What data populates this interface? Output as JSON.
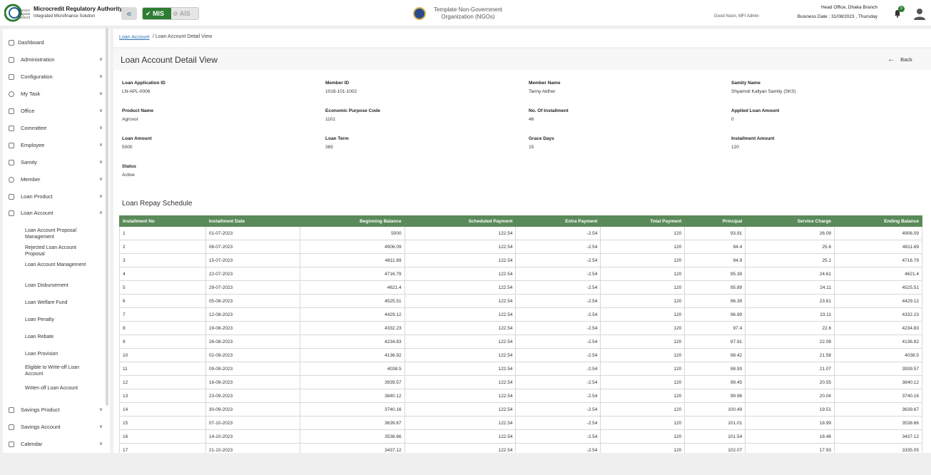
{
  "header": {
    "brand_title": "Microcredit Regulatory Authority",
    "brand_subtitle": "Integrated Microfinance Solution",
    "mode_mis": "MIS",
    "mode_ais": "AIS",
    "org_name": "Template Non-Government Organization (NGOs)",
    "greeting": "Good Noon, MFI Admin",
    "branch": "Head Office, Dhaka Branch",
    "business_date": "Business Date : 31/08/2023 , Thursday",
    "notification_count": "0"
  },
  "sidebar": {
    "dashboard": "Dashboard",
    "items": [
      {
        "label": "Administration",
        "icon": "admin-icon"
      },
      {
        "label": "Configuration",
        "icon": "config-icon"
      },
      {
        "label": "My Task",
        "icon": "task-icon"
      },
      {
        "label": "Office",
        "icon": "office-icon"
      },
      {
        "label": "Committee",
        "icon": "committee-icon"
      },
      {
        "label": "Employee",
        "icon": "employee-icon"
      },
      {
        "label": "Samity",
        "icon": "samity-icon"
      },
      {
        "label": "Member",
        "icon": "member-icon"
      },
      {
        "label": "Loan Product",
        "icon": "loan-product-icon"
      },
      {
        "label": "Loan Account",
        "icon": "loan-account-icon"
      }
    ],
    "loan_account_sub": [
      "Loan Account Proposal Management",
      "Rejected Loan Account Proposal",
      "Loan Account Management",
      "Loan Disbursement",
      "Loan Welfare Fund",
      "Loan Penalty",
      "Loan Rebate",
      "Loan Provision",
      "Eligible to Write-off Loan Account",
      "Writen off Loan Account"
    ],
    "bottom_items": [
      {
        "label": "Savings Product",
        "icon": "savings-product-icon"
      },
      {
        "label": "Savings Account",
        "icon": "savings-account-icon"
      },
      {
        "label": "Calendar",
        "icon": "calendar-icon"
      }
    ]
  },
  "breadcrumb": {
    "link": "Loan Account",
    "current": "/ Loan Account Detail View"
  },
  "page": {
    "title": "Loan Account Detail View",
    "back": "Back"
  },
  "details": [
    {
      "label": "Loan Application ID",
      "value": "LN-APL-0006"
    },
    {
      "label": "Member ID",
      "value": "1018-101-1002"
    },
    {
      "label": "Member Name",
      "value": "Tanny Akther"
    },
    {
      "label": "Samity Name",
      "value": "Shyamoli Kallyan Samity (SKS)"
    },
    {
      "label": "Product Name",
      "value": "Agrosor"
    },
    {
      "label": "Economic Purpose Code",
      "value": "1101"
    },
    {
      "label": "No. Of Installment",
      "value": "46"
    },
    {
      "label": "Applied Loan Amount",
      "value": "0"
    },
    {
      "label": "Loan Amount",
      "value": "5000"
    },
    {
      "label": "Loan Term",
      "value": "365"
    },
    {
      "label": "Grace Days",
      "value": "15"
    },
    {
      "label": "Installment Amount",
      "value": "120"
    },
    {
      "label": "Status",
      "value": "Active"
    }
  ],
  "schedule": {
    "title": "Loan Repay Schedule",
    "columns": [
      "Installment No",
      "Installment Date",
      "Beginning Balance",
      "Scheduled Payment",
      "Extra Payment",
      "Total Payment",
      "Principal",
      "Service Charge",
      "Ending Balance"
    ],
    "rows": [
      [
        "1",
        "01-07-2023",
        "5000",
        "122.54",
        "-2.54",
        "120",
        "93.91",
        "26.09",
        "4906.09"
      ],
      [
        "2",
        "08-07-2023",
        "4906.09",
        "122.54",
        "-2.54",
        "120",
        "94.4",
        "25.6",
        "4811.69"
      ],
      [
        "3",
        "15-07-2023",
        "4811.69",
        "122.54",
        "-2.54",
        "120",
        "94.9",
        "25.1",
        "4716.79"
      ],
      [
        "4",
        "22-07-2023",
        "4716.79",
        "122.54",
        "-2.54",
        "120",
        "95.39",
        "24.61",
        "4621.4"
      ],
      [
        "5",
        "29-07-2023",
        "4621.4",
        "122.54",
        "-2.54",
        "120",
        "95.89",
        "24.11",
        "4525.51"
      ],
      [
        "6",
        "05-08-2023",
        "4525.51",
        "122.54",
        "-2.54",
        "120",
        "96.39",
        "23.61",
        "4429.12"
      ],
      [
        "7",
        "12-08-2023",
        "4429.12",
        "122.54",
        "-2.54",
        "120",
        "96.89",
        "23.11",
        "4332.23"
      ],
      [
        "8",
        "19-08-2023",
        "4332.23",
        "122.54",
        "-2.54",
        "120",
        "97.4",
        "22.6",
        "4234.83"
      ],
      [
        "9",
        "26-08-2023",
        "4234.83",
        "122.54",
        "-2.54",
        "120",
        "97.91",
        "22.09",
        "4136.92"
      ],
      [
        "10",
        "02-09-2023",
        "4136.92",
        "122.54",
        "-2.54",
        "120",
        "98.42",
        "21.58",
        "4038.5"
      ],
      [
        "11",
        "09-09-2023",
        "4038.5",
        "122.54",
        "-2.54",
        "120",
        "98.93",
        "21.07",
        "3939.57"
      ],
      [
        "12",
        "16-09-2023",
        "3939.57",
        "122.54",
        "-2.54",
        "120",
        "99.45",
        "20.55",
        "3840.12"
      ],
      [
        "13",
        "23-09-2023",
        "3840.12",
        "122.54",
        "-2.54",
        "120",
        "99.96",
        "20.04",
        "3740.16"
      ],
      [
        "14",
        "30-09-2023",
        "3740.16",
        "122.54",
        "-2.54",
        "120",
        "100.49",
        "19.51",
        "3639.67"
      ],
      [
        "15",
        "07-10-2023",
        "3639.67",
        "122.54",
        "-2.54",
        "120",
        "101.01",
        "18.99",
        "3538.66"
      ],
      [
        "16",
        "14-10-2023",
        "3538.66",
        "122.54",
        "-2.54",
        "120",
        "101.54",
        "18.46",
        "3437.12"
      ],
      [
        "17",
        "21-10-2023",
        "3437.12",
        "122.54",
        "-2.54",
        "120",
        "102.07",
        "17.93",
        "3335.05"
      ]
    ]
  },
  "colors": {
    "brand_green": "#2e7d32",
    "table_header": "#5a8a5a",
    "link": "#2a6fb0"
  }
}
